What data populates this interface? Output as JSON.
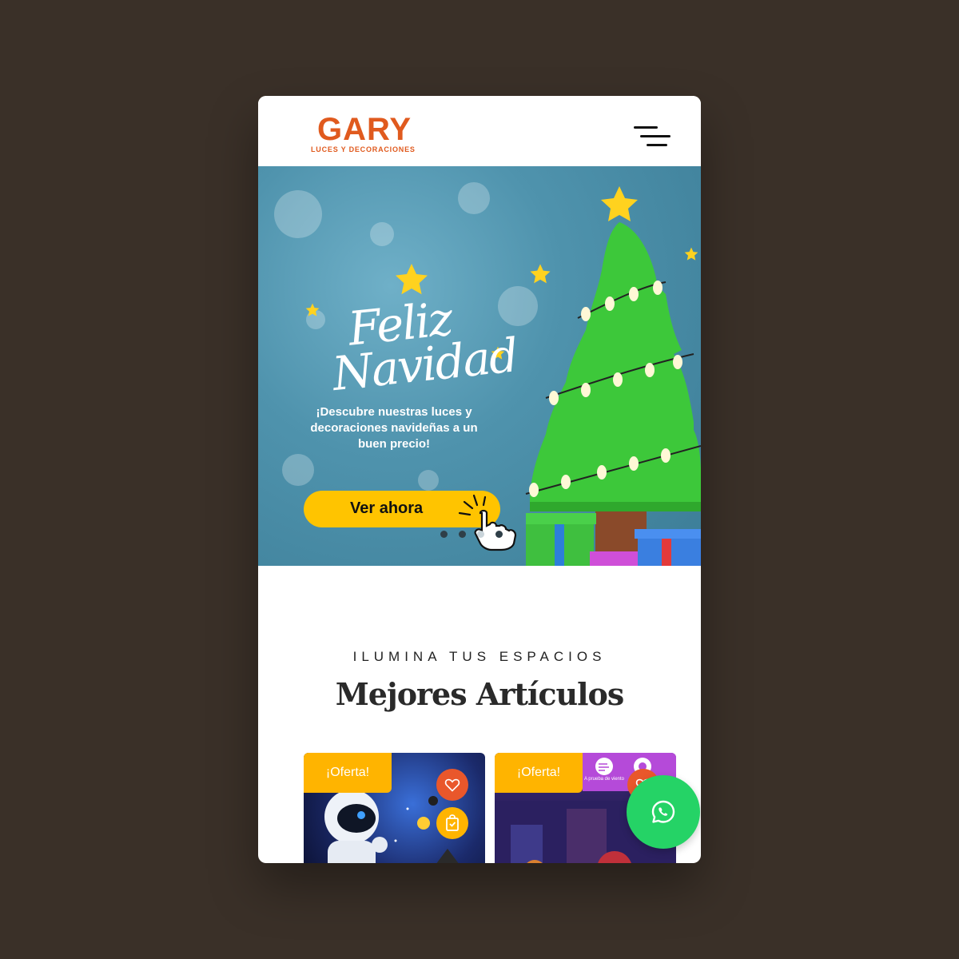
{
  "brand": {
    "name": "GARY",
    "tagline": "LUCES Y DECORACIONES",
    "color": "#e05a1e"
  },
  "header": {
    "menu_icon": "hamburger-menu-icon"
  },
  "hero": {
    "title": "Feliz Navidad",
    "subtitle": "¡Descubre nuestras luces y decoraciones navideñas a un buen precio!",
    "cta_label": "Ver ahora",
    "slide_count": 4,
    "active_slide": 3,
    "accent": "#ffc400"
  },
  "section": {
    "eyebrow": "ILUMINA TUS ESPACIOS",
    "title": "Mejores Artículos"
  },
  "products": [
    {
      "badge": "¡Oferta!",
      "wishlist_icon": "heart-icon",
      "cart_icon": "shopping-bag-icon"
    },
    {
      "badge": "¡Oferta!",
      "wishlist_icon": "heart-icon",
      "side_label": "A prueba de viento"
    }
  ],
  "floating": {
    "whatsapp_icon": "whatsapp-icon",
    "color": "#25d366"
  }
}
